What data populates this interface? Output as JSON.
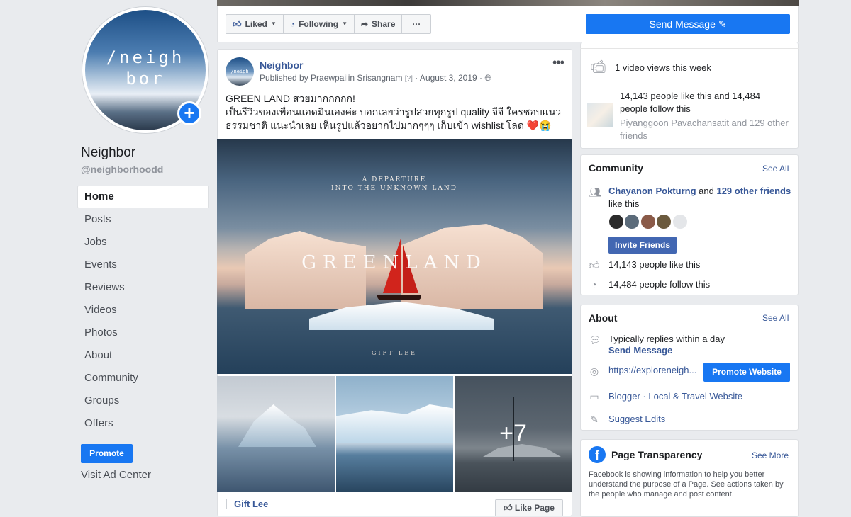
{
  "page": {
    "avatar_text": "/neigh bor",
    "name": "Neighbor",
    "handle": "@neighborhoodd"
  },
  "nav": {
    "items": [
      "Home",
      "Posts",
      "Jobs",
      "Events",
      "Reviews",
      "Videos",
      "Photos",
      "About",
      "Community",
      "Groups",
      "Offers"
    ],
    "active": "Home",
    "promote_label": "Promote",
    "ad_center_label": "Visit Ad Center"
  },
  "action_bar": {
    "liked_label": "Liked",
    "following_label": "Following",
    "share_label": "Share",
    "more_label": "···",
    "send_message_label": "Send Message"
  },
  "post": {
    "author": "Neighbor",
    "published_by": "Published by Praewpailin Srisangnam",
    "help_mark": "[?]",
    "date": "· August 3, 2019 ·",
    "text_line1": "GREEN LAND สวยมากกกกก!",
    "text_line2": "เป็นรีวิวของเพื่อนแอดมินเองค่ะ บอกเลยว่ารูปสวยทุกรูป quality จีจี ใครชอบแนว ธรรมชาติ แนะนำเลย เห็นรูปแล้วอยากไปมากๆๆๆ เก็บเข้า wishlist โลด ❤️😭",
    "main_image": {
      "subtitle_line1": "A DEPARTURE",
      "subtitle_line2": "INTO THE UNKNOWN LAND",
      "title": "GREENLAND",
      "credit": "GIFT LEE"
    },
    "more_photos_label": "+7",
    "shared_from": "Gift Lee",
    "like_page_label": "Like Page"
  },
  "right": {
    "video_views": "1 video views this week",
    "likes_follow": "14,143 people like this and 14,484 people follow this",
    "friends_like": "Piyanggoon Pavachansatit and 129 other friends",
    "community": {
      "title": "Community",
      "see_all": "See All",
      "friend_name": "Chayanon Pokturng",
      "and_text": "and",
      "other_friends": "129 other friends",
      "like_this": "like this",
      "invite_label": "Invite Friends",
      "likes": "14,143 people like this",
      "follows": "14,484 people follow this"
    },
    "about": {
      "title": "About",
      "see_all": "See All",
      "replies": "Typically replies within a day",
      "send_message": "Send Message",
      "website": "https://exploreneigh...",
      "promote_website": "Promote Website",
      "category": "Blogger · Local & Travel Website",
      "suggest_edits": "Suggest Edits"
    },
    "transparency": {
      "title": "Page Transparency",
      "see_more": "See More",
      "text": "Facebook is showing information to help you better understand the purpose of a Page. See actions taken by the people who manage and post content."
    }
  },
  "colors": {
    "accent": "#1877f2",
    "link": "#385898",
    "background": "#e9ebee"
  }
}
